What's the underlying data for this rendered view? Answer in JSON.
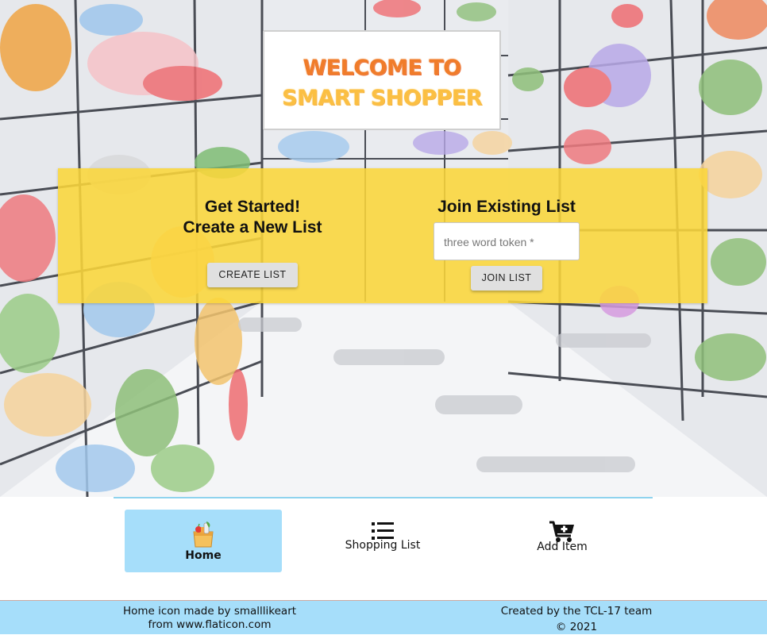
{
  "header": {
    "title_line1": "WELCOME TO",
    "title_line2": "SMART SHOPPER"
  },
  "create": {
    "heading_line1": "Get Started!",
    "heading_line2": "Create a New List",
    "button_label": "CREATE LIST"
  },
  "join": {
    "heading": "Join Existing List",
    "input_placeholder": "three word token *",
    "input_value": "",
    "button_label": "JOIN LIST"
  },
  "nav": {
    "items": [
      {
        "label": "Home",
        "icon": "grocery-bag-icon",
        "active": true
      },
      {
        "label": "Shopping List",
        "icon": "list-icon",
        "active": false
      },
      {
        "label": "Add Item",
        "icon": "cart-plus-icon",
        "active": false
      }
    ]
  },
  "footer": {
    "credit_line1": "Home icon made by smalllikeart",
    "credit_line2": "from www.flaticon.com",
    "team_line1": "Created by the TCL-17 team",
    "team_line2": "© 2021"
  },
  "colors": {
    "panel": "#fad63a",
    "nav_active": "#a6defa",
    "footer": "#a6defa",
    "title_orange": "#f07c2a",
    "title_yellow": "#fbbf42"
  }
}
